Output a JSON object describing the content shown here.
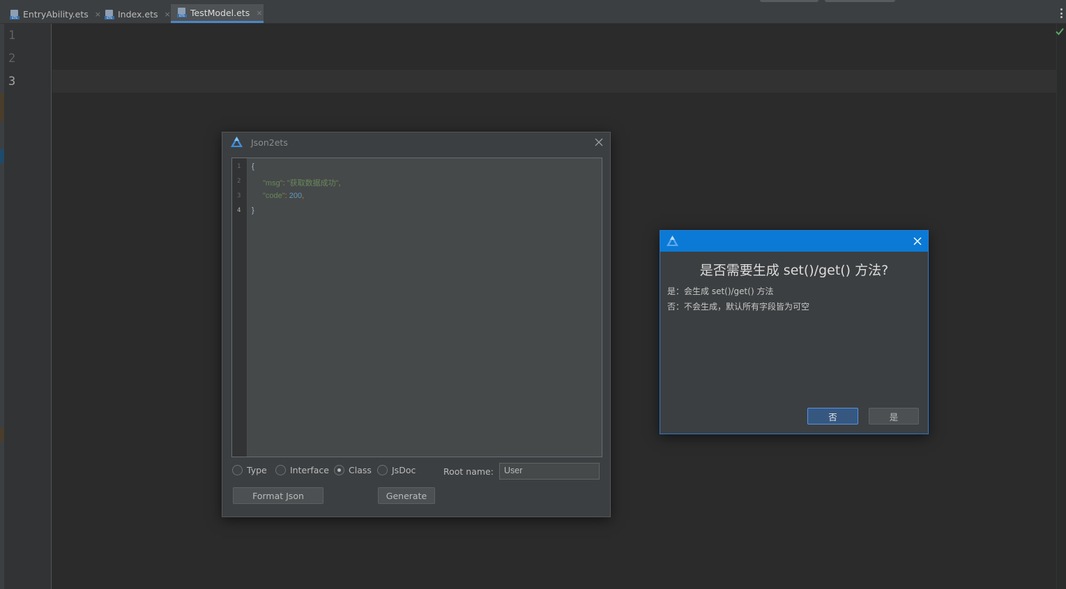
{
  "tabs": [
    {
      "label": "EntryAbility.ets",
      "icon": "ets-file-icon",
      "active": false
    },
    {
      "label": "Index.ets",
      "icon": "ets-file-icon",
      "active": false
    },
    {
      "label": "TestModel.ets",
      "icon": "ets-file-icon",
      "active": true
    }
  ],
  "tab_close_glyph": "×",
  "editor": {
    "line_numbers": [
      "1",
      "2",
      "3"
    ],
    "current_line": "3",
    "inspection_status_icon": "checkmark-icon",
    "inspection_color": "#59a869"
  },
  "json2ets_dialog": {
    "title": "Json2ets",
    "icon": "deveco-logo-icon",
    "code_line_numbers": [
      "1",
      "2",
      "3",
      "4"
    ],
    "code": {
      "line1": "{",
      "msg_key": "\"msg\"",
      "msg_value": "\"获取数据成功\"",
      "code_key": "\"code\"",
      "code_value": "200",
      "line4": "}"
    },
    "options": [
      {
        "label": "Type",
        "selected": false
      },
      {
        "label": "Interface",
        "selected": false
      },
      {
        "label": "Class",
        "selected": true
      },
      {
        "label": "JsDoc",
        "selected": false
      }
    ],
    "root_name_label": "Root name:",
    "root_name_value": "User",
    "format_button": "Format Json",
    "generate_button": "Generate"
  },
  "confirm_dialog": {
    "icon": "deveco-logo-icon",
    "question": "是否需要生成 set()/get() 方法?",
    "yes_desc": "是：会生成 set()/get() 方法",
    "no_desc": "否：不会生成，默认所有字段皆为可空",
    "no_button": "否",
    "yes_button": "是",
    "titlebar_color": "#0a7ad6"
  }
}
